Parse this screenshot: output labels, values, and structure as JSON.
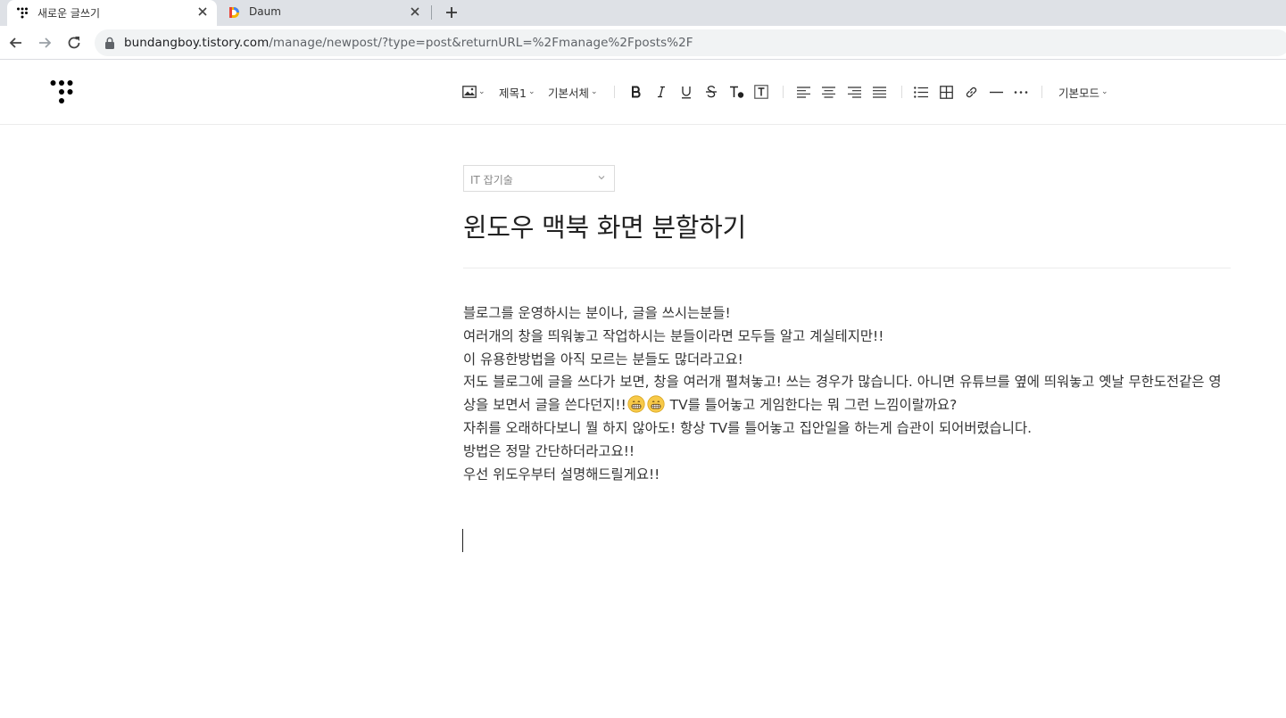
{
  "browser": {
    "tabs": [
      {
        "title": "새로운 글쓰기",
        "active": true,
        "favicon": "tistory-icon"
      },
      {
        "title": "Daum",
        "active": false,
        "favicon": "daum-icon"
      }
    ],
    "url_host": "bundangboy.tistory.com",
    "url_path": "/manage/newpost/?type=post&returnURL=%2Fmanage%2Fposts%2F"
  },
  "toolbar": {
    "heading_label": "제목1",
    "font_label": "기본서체",
    "mode_label": "기본모드"
  },
  "editor": {
    "category": "IT 잡기술",
    "title": "윈도우 맥북 화면 분할하기",
    "paragraphs": [
      "블로그를 운영하시는 분이나, 글을 쓰시는분들!",
      "여러개의 창을 띄워놓고 작업하시는 분들이라면 모두들 알고 계실테지만!!",
      "이 유용한방법을 아직 모르는 분들도 많더라고요!"
    ],
    "para4_part1": "저도 블로그에 글을 쓰다가 보면, 창을 여러개 펼쳐놓고! 쓰는 경우가 많습니다. 아니면 유튜브를 옆에 띄워놓고 옛날 무한도전같은 영상을 보면서 글을 쓴다던지!!",
    "para4_part2": " TV를 틀어놓고 게임한다는 뭐 그런 느낌이랄까요?",
    "paragraphs_after": [
      "자취를 오래하다보니 뭘 하지 않아도! 항상 TV를 틀어놓고 집안일을 하는게 습관이 되어버렸습니다.",
      "방법은 정말 간단하더라고요!!",
      "우선 위도우부터 설명해드릴게요!!"
    ],
    "emoji_count": 2
  }
}
